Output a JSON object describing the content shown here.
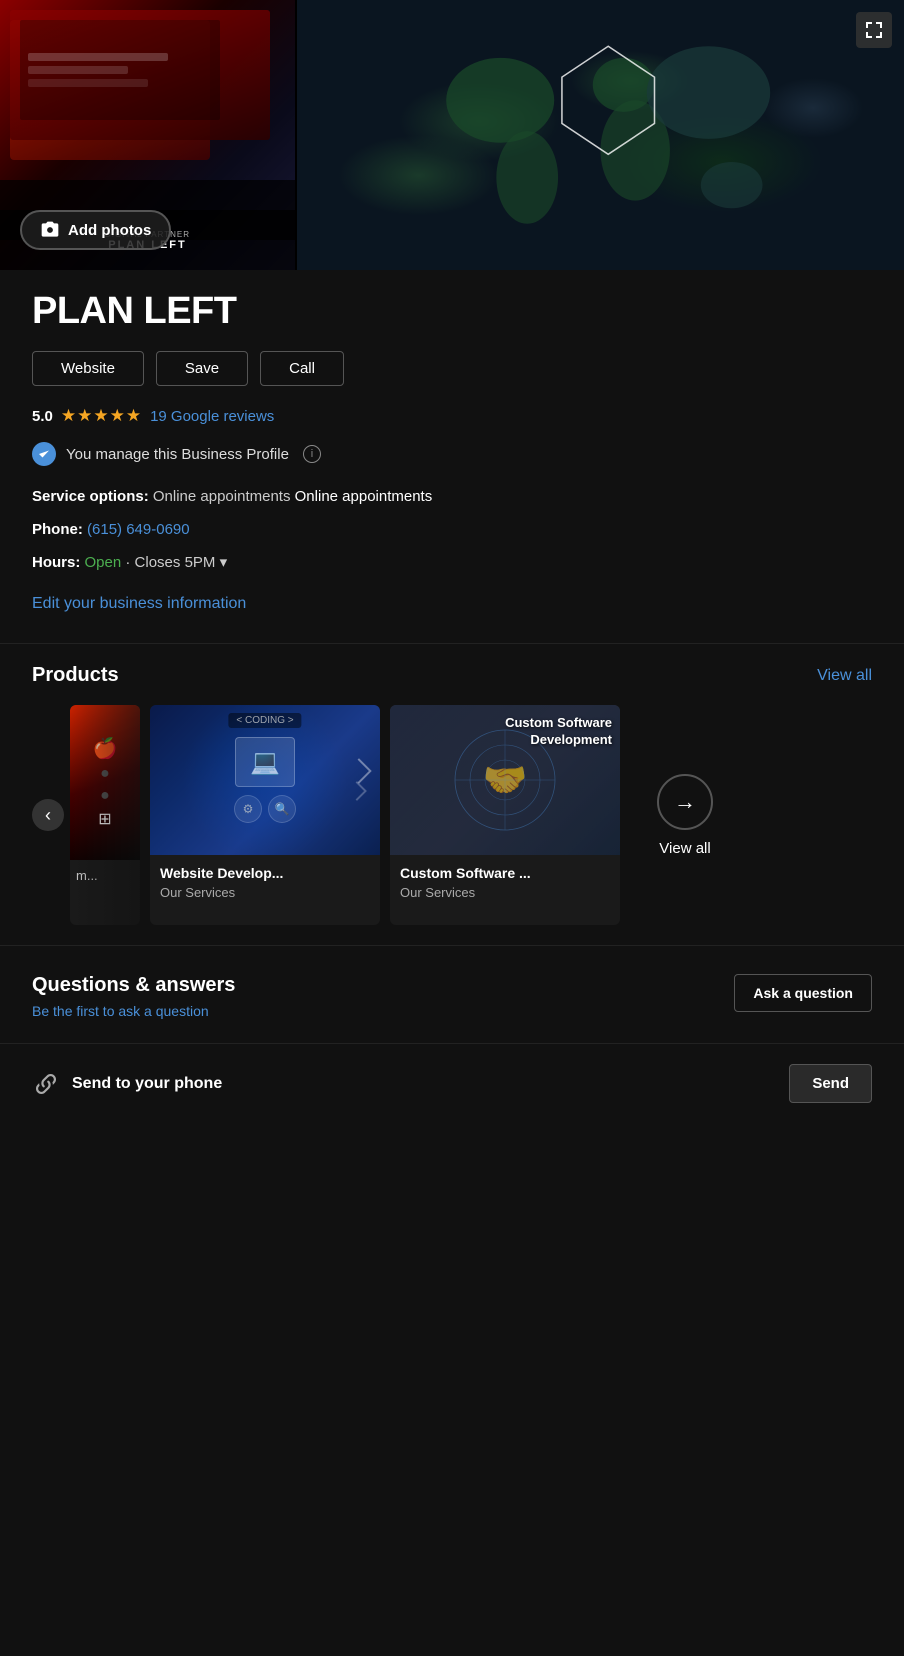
{
  "header": {
    "add_photos_label": "Add photos",
    "expand_icon": "expand-icon"
  },
  "business": {
    "name": "PLAN LEFT",
    "buttons": {
      "website": "Website",
      "save": "Save",
      "call": "Call"
    },
    "rating": {
      "score": "5.0",
      "stars": "★★★★★",
      "reviews_text": "19 Google reviews"
    },
    "managed_text": "You manage this Business Profile",
    "service_options_label": "Service options:",
    "service_options_value": "Online appointments",
    "phone_label": "Phone:",
    "phone_value": "(615) 649-0690",
    "hours_label": "Hours:",
    "hours_status": "Open",
    "hours_detail": "· Closes 5PM",
    "edit_link": "Edit your business information"
  },
  "products": {
    "section_title": "Products",
    "view_all_label": "View all",
    "items": [
      {
        "title": "Website Develop...",
        "subtitle": "Our Services",
        "image_type": "website-dev"
      },
      {
        "title": "Custom Software ...",
        "subtitle": "Our Services",
        "image_type": "custom-software"
      }
    ],
    "partial_first_label": "m...",
    "coding_label": "< CODING >",
    "custom_software_overlay": "Custom Software\nDevelopment",
    "view_all_circle_label": "View all",
    "arrow": "→"
  },
  "qa": {
    "title": "Questions & answers",
    "subtitle": "Be the first to ask a question",
    "ask_button_label": "Ask a question"
  },
  "send": {
    "label": "Send to your phone",
    "button_label": "Send",
    "icon": "send-icon"
  },
  "colors": {
    "background": "#111111",
    "accent_blue": "#4a90d9",
    "accent_green": "#4caf50",
    "star_yellow": "#f5a623",
    "border": "#555555"
  }
}
